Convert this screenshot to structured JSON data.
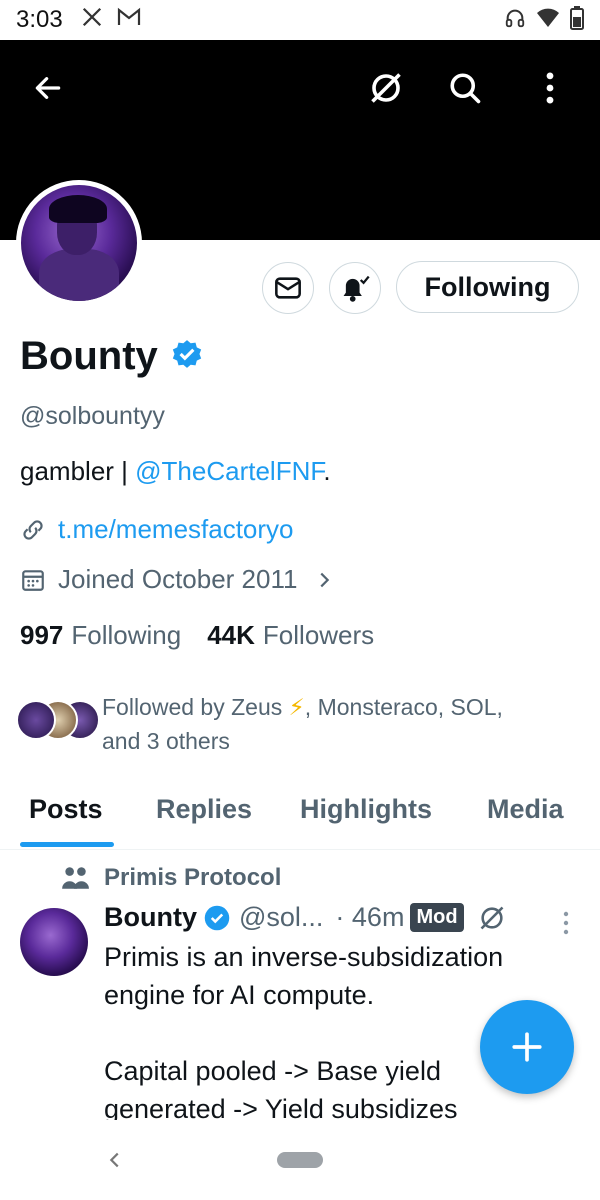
{
  "status_bar": {
    "time": "3:03"
  },
  "profile": {
    "name": "Bounty",
    "handle": "@solbountyy",
    "bio_prefix": "gambler | ",
    "bio_mention": "@TheCartelFNF",
    "bio_suffix": ".",
    "link": "t.me/memesfactoryo",
    "joined": "Joined October 2011",
    "following_count": "997",
    "following_label": "Following",
    "followers_count": "44K",
    "followers_label": "Followers",
    "followed_by_prefix": "Followed by Zeus ",
    "followed_by_emoji": "⚡",
    "followed_by_rest": ", Monsteraco, SOL,",
    "followed_by_line2": "and 3 others",
    "follow_button": "Following"
  },
  "tabs": [
    {
      "label": "Posts",
      "active": true
    },
    {
      "label": "Replies",
      "active": false
    },
    {
      "label": "Highlights",
      "active": false
    },
    {
      "label": "Media",
      "active": false
    }
  ],
  "post": {
    "community": "Primis Protocol",
    "author": "Bounty",
    "handle": "@sol...",
    "time": "· 46m",
    "badge": "Mod",
    "body": "Primis is an inverse-subsidization engine for AI compute.\n\nCapital pooled -> Base yield generated -> Yield subsidizes"
  },
  "colors": {
    "accent": "#1d9bf0",
    "text": "#0f1419",
    "muted": "#536471",
    "banner": "#000000"
  }
}
